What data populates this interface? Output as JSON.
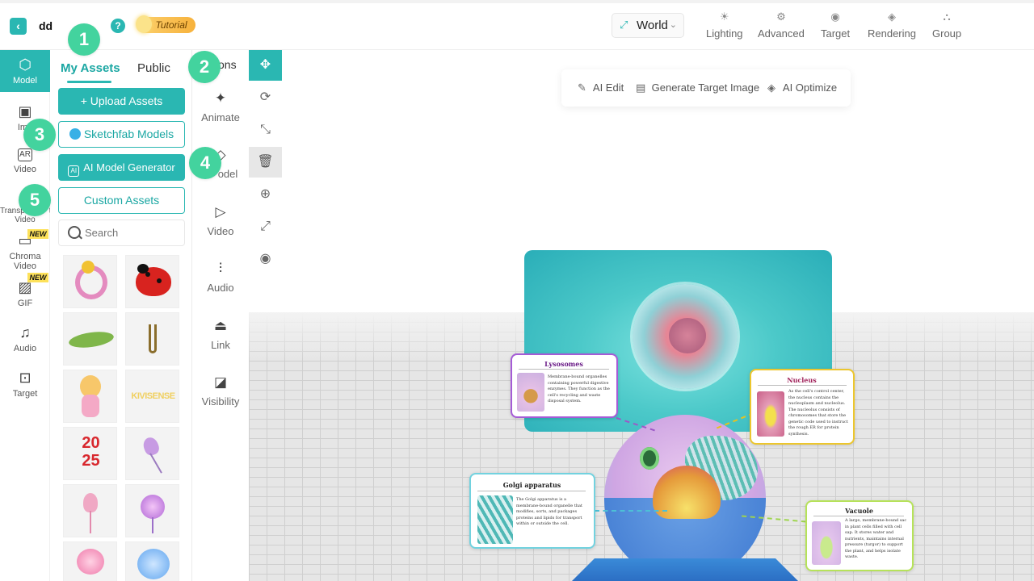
{
  "header": {
    "project_name": "dd",
    "tutorial_label": "Tutorial",
    "coordinate_mode": "World",
    "tools": [
      {
        "label": "Lighting",
        "icon": "sun-icon"
      },
      {
        "label": "Advanced",
        "icon": "gear-icon"
      },
      {
        "label": "Target",
        "icon": "target-icon"
      },
      {
        "label": "Rendering",
        "icon": "paint-bucket-icon"
      },
      {
        "label": "Group",
        "icon": "group-icon"
      }
    ]
  },
  "rail": {
    "items": [
      {
        "label": "Model",
        "icon": "cube-icon",
        "active": true
      },
      {
        "label": "Ima",
        "icon": "image-icon"
      },
      {
        "label": "Video",
        "icon": "ar-video-icon"
      },
      {
        "label": "Transp",
        "label2": "t",
        "label3": "Video",
        "icon": "transparent-video-icon"
      },
      {
        "label": "Chroma",
        "label2": "Video",
        "icon": "chroma-video-icon",
        "badge": "NEW"
      },
      {
        "label": "GIF",
        "icon": "gif-icon",
        "badge": "NEW"
      },
      {
        "label": "Audio",
        "icon": "music-note-icon"
      },
      {
        "label": "Target",
        "icon": "target-image-icon"
      }
    ]
  },
  "assets": {
    "tabs": [
      "My Assets",
      "Public"
    ],
    "active_tab": "My Assets",
    "upload_label": "Upload Assets",
    "sketchfab_label": "Sketchfab Models",
    "ai_generator_label": "AI Model Generator",
    "custom_label": "Custom Assets",
    "search_placeholder": "Search",
    "partial_tab": "ons",
    "thumbnails": [
      "flower-wreath",
      "ladybug",
      "green-leaf",
      "hook",
      "angel-figure",
      "kivisense-text",
      "2025-numbers",
      "purple-tulip",
      "pink-lily",
      "purple-flower",
      "pink-blossom",
      "blue-flower"
    ]
  },
  "actions": [
    {
      "label": "Animate",
      "icon": "sparkle-icon"
    },
    {
      "label": "odel",
      "icon": "model-icon"
    },
    {
      "label": "Video",
      "icon": "play-icon"
    },
    {
      "label": "Audio",
      "icon": "sliders-icon"
    },
    {
      "label": "Link",
      "icon": "link-icon"
    },
    {
      "label": "Visibility",
      "icon": "visibility-icon"
    }
  ],
  "view_tools": [
    "move-icon",
    "rotate-icon",
    "scale-icon",
    "trash-icon",
    "crosshair-icon",
    "fit-icon",
    "eye-icon"
  ],
  "ai_toolbar": [
    {
      "label": "AI Edit",
      "icon": "wand-icon"
    },
    {
      "label": "Generate Target Image",
      "icon": "image-gen-icon"
    },
    {
      "label": "AI Optimize",
      "icon": "layers-icon"
    }
  ],
  "cards": {
    "lysosomes": {
      "title": "Lysosomes",
      "text": "Membrane-bound organelles containing powerful digestive enzymes. They function as the cell's recycling and waste disposal system."
    },
    "nucleus": {
      "title": "Nucleus",
      "text": "As the cell's control center, the nucleus contains the nucleoplasm and nucleolus. The nucleolus consists of chromosomes that store the genetic code used to instruct the rough ER for protein synthesis."
    },
    "golgi": {
      "title": "Golgi apparatus",
      "text": "The Golgi apparatus is a membrane-bound organelle that modifies, sorts, and packages proteins and lipids for transport within or outside the cell."
    },
    "vacuole": {
      "title": "Vacuole",
      "text": "A large, membrane-bound sac in plant cells filled with cell sap. It stores water and nutrients, maintains internal pressure (turgor) to support the plant, and helps isolate waste."
    }
  },
  "callouts": [
    "1",
    "2",
    "3",
    "4",
    "5"
  ],
  "colors": {
    "accent": "#2ab7b2",
    "callout": "#43d39e",
    "badge": "#fde15a"
  }
}
